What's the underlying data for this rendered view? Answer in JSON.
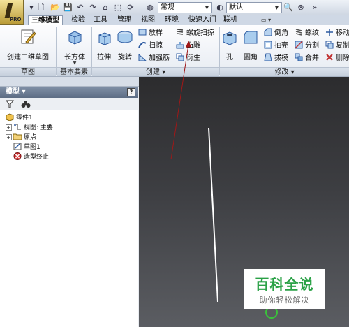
{
  "app": {
    "pro_badge": "PRO"
  },
  "quick_access": {
    "style_value": "常规",
    "material_value": "默认"
  },
  "tabs": [
    "三维模型",
    "检验",
    "工具",
    "管理",
    "视图",
    "环境",
    "快速入门",
    "联机"
  ],
  "ribbon": {
    "sketch_panel": {
      "title": "草图",
      "create_sketch": "创建二维草图"
    },
    "primitives_panel": {
      "title": "基本要素",
      "box": "长方体"
    },
    "create_panel": {
      "title": "创建 ▾",
      "extrude": "拉伸",
      "revolve": "旋转",
      "loft": "放样",
      "sweep": "扫掠",
      "rib": "加强筋",
      "coil": "螺旋扫掠",
      "emboss": "凸雕",
      "derive": "衍生"
    },
    "modify_panel": {
      "title": "修改 ▾",
      "hole": "孔",
      "fillet": "圆角",
      "chamfer": "倒角",
      "shell": "抽壳",
      "draft": "拔模",
      "thread": "螺纹",
      "split": "分割",
      "combine": "合并",
      "move": "移动",
      "copy": "复制",
      "delete": "删除"
    }
  },
  "browser": {
    "title": "模型 ▾",
    "help": "?",
    "tree": [
      {
        "label": "零件1"
      },
      {
        "label": "视图: 主要"
      },
      {
        "label": "原点"
      },
      {
        "label": "草图1"
      },
      {
        "label": "造型终止"
      }
    ]
  },
  "watermark": {
    "title": "百科全说",
    "subtitle": "助你轻松解决"
  },
  "colors": {
    "ribbon_accent": "#2c5aa0",
    "watermark_green": "#2aa146",
    "annotation_arrow": "#a01818"
  }
}
